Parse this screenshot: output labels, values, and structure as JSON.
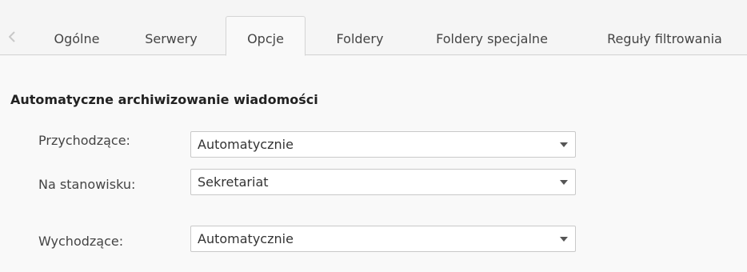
{
  "tabs": [
    {
      "label": "Ogólne",
      "active": false
    },
    {
      "label": "Serwery",
      "active": false
    },
    {
      "label": "Opcje",
      "active": true
    },
    {
      "label": "Foldery",
      "active": false
    },
    {
      "label": "Foldery specjalne",
      "active": false
    },
    {
      "label": "Reguły filtrowania",
      "active": false
    }
  ],
  "section": {
    "title": "Automatyczne archiwizowanie wiadomości",
    "fields": [
      {
        "label": "Przychodzące:",
        "value": "Automatycznie"
      },
      {
        "label": "Na stanowisku:",
        "value": "Sekretariat"
      },
      {
        "label": "Wychodzące:",
        "value": "Automatycznie"
      }
    ]
  },
  "icons": {
    "scroll_left": "chevron-left-icon",
    "dropdown": "chevron-down-icon"
  }
}
